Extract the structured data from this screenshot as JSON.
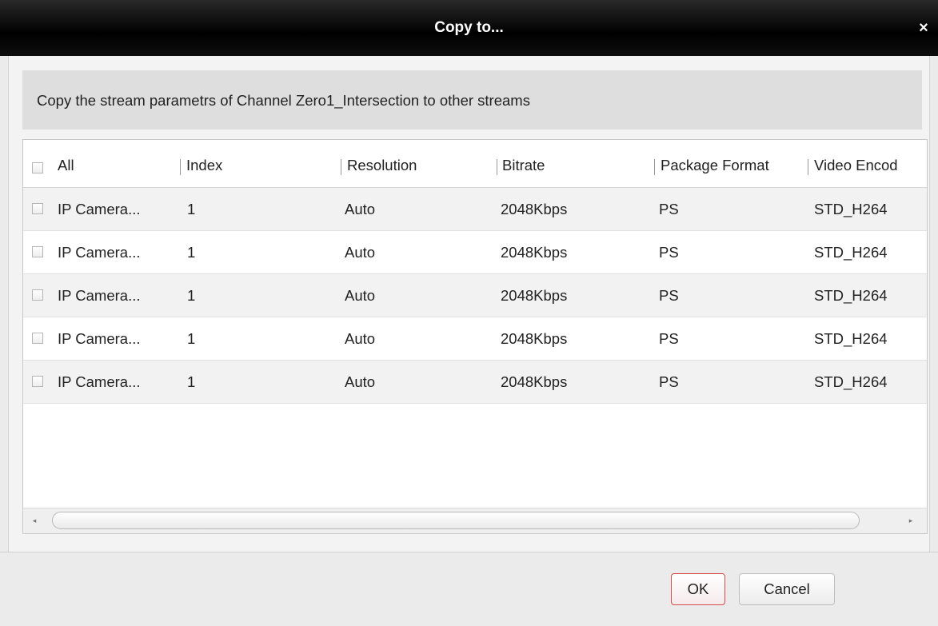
{
  "dialog": {
    "title": "Copy to...",
    "close_glyph": "×"
  },
  "description": "Copy the stream parametrs of Channel Zero1_Intersection to other streams",
  "table": {
    "headers": {
      "all": "All",
      "index": "Index",
      "resolution": "Resolution",
      "bitrate": "Bitrate",
      "package_format": "Package Format",
      "video_encoding": "Video Encod"
    },
    "rows": [
      {
        "name": "IP Camera...",
        "index": "1",
        "resolution": "Auto",
        "bitrate": "2048Kbps",
        "package_format": "PS",
        "video_encoding": "STD_H264",
        "checked": false
      },
      {
        "name": "IP Camera...",
        "index": "1",
        "resolution": "Auto",
        "bitrate": "2048Kbps",
        "package_format": "PS",
        "video_encoding": "STD_H264",
        "checked": false
      },
      {
        "name": "IP Camera...",
        "index": "1",
        "resolution": "Auto",
        "bitrate": "2048Kbps",
        "package_format": "PS",
        "video_encoding": "STD_H264",
        "checked": false
      },
      {
        "name": "IP Camera...",
        "index": "1",
        "resolution": "Auto",
        "bitrate": "2048Kbps",
        "package_format": "PS",
        "video_encoding": "STD_H264",
        "checked": false
      },
      {
        "name": "IP Camera...",
        "index": "1",
        "resolution": "Auto",
        "bitrate": "2048Kbps",
        "package_format": "PS",
        "video_encoding": "STD_H264",
        "checked": false
      }
    ],
    "scroll_left_glyph": "◂",
    "scroll_right_glyph": "▸"
  },
  "buttons": {
    "ok": "OK",
    "cancel": "Cancel"
  },
  "colors": {
    "titlebar": "#000000",
    "ok_border": "#d64b4b",
    "row_alt": "#f2f2f2"
  }
}
